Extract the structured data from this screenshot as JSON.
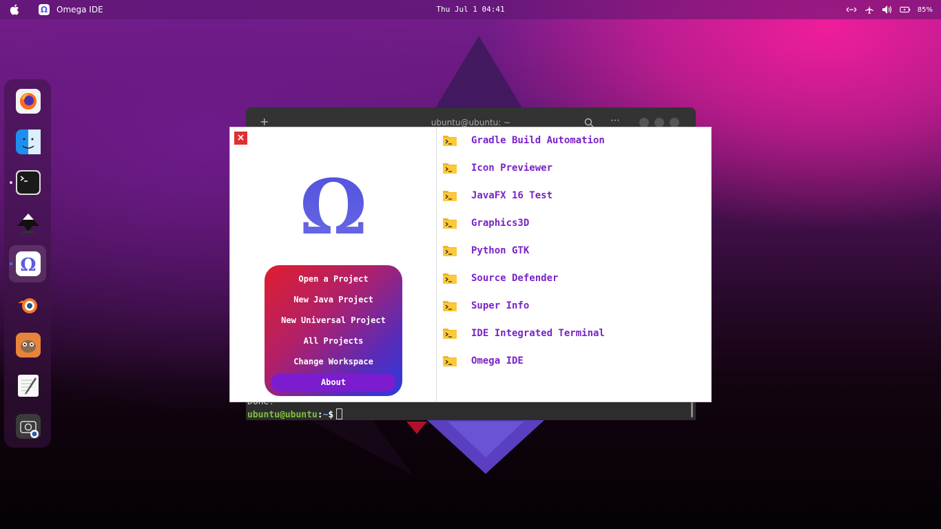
{
  "topbar": {
    "app_name": "Omega IDE",
    "app_icon_glyph": "Ω",
    "clock": "Thu Jul 1 04:41",
    "battery": "85%",
    "icons": [
      "apple-logo-icon",
      "network-icon",
      "airplane-mode-icon",
      "volume-icon",
      "battery-icon"
    ]
  },
  "dock": {
    "items": [
      "firefox",
      "finder",
      "terminal",
      "inkscape",
      "omega-ide",
      "blender",
      "gimp",
      "text-editor",
      "screenshot"
    ]
  },
  "terminal": {
    "title": "ubuntu@ubuntu: ~",
    "new_tab": "+",
    "menu": "⋯",
    "last_output": "Done!",
    "prompt_user": "ubuntu@ubuntu",
    "prompt_sep": ":",
    "prompt_path": "~",
    "prompt_symbol": "$"
  },
  "dialog": {
    "close_label": "×",
    "logo_glyph": "Ω",
    "menu": [
      {
        "label": "Open a Project"
      },
      {
        "label": "New Java Project"
      },
      {
        "label": "New Universal Project"
      },
      {
        "label": "All Projects"
      },
      {
        "label": "Change Workspace"
      },
      {
        "label": "About",
        "active": true
      }
    ],
    "projects": [
      "Gradle Build Automation",
      "Icon Previewer",
      "JavaFX 16 Test",
      "Graphics3D",
      "Python GTK",
      "Source Defender",
      "Super Info",
      "IDE Integrated Terminal",
      "Omega IDE"
    ]
  },
  "colors": {
    "accent": "#7a22c8",
    "menu_active": "#7b1ccf",
    "close": "#e03030"
  }
}
